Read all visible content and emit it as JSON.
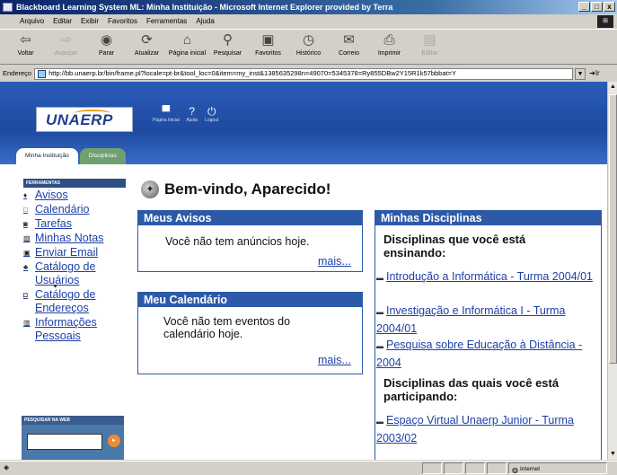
{
  "window": {
    "title": "Blackboard Learning System ML: Minha Instituição - Microsoft Internet Explorer provided by Terra"
  },
  "menu": [
    "Arquivo",
    "Editar",
    "Exibir",
    "Favoritos",
    "Ferramentas",
    "Ajuda"
  ],
  "toolbar": [
    {
      "icon": "back-arrow-icon",
      "label": "Voltar",
      "enabled": true
    },
    {
      "icon": "forward-arrow-icon",
      "label": "Avançar",
      "enabled": false
    },
    {
      "icon": "stop-icon",
      "label": "Parar",
      "enabled": true
    },
    {
      "icon": "refresh-icon",
      "label": "Atualizar",
      "enabled": true
    },
    {
      "icon": "home-icon",
      "label": "Página inicial",
      "enabled": true
    },
    {
      "icon": "search-icon",
      "label": "Pesquisar",
      "enabled": true
    },
    {
      "icon": "favorites-icon",
      "label": "Favoritos",
      "enabled": true
    },
    {
      "icon": "history-icon",
      "label": "Histórico",
      "enabled": true
    },
    {
      "icon": "mail-icon",
      "label": "Correio",
      "enabled": true
    },
    {
      "icon": "print-icon",
      "label": "Imprimir",
      "enabled": true
    },
    {
      "icon": "edit-icon",
      "label": "Editar",
      "enabled": false
    }
  ],
  "address": {
    "label": "Endereço",
    "url": "http://bb.unaerp.br/bin/frame.pl?locale=pt-br&tool_loc=0&item=my_inst&1385635298n=49070=5345378=Ry855DBw2Y15R1k57bbbat=Y",
    "go": "Ir"
  },
  "header": {
    "logo_text": "UNAERP",
    "icons": [
      {
        "icon": "home-icon",
        "label": "Página Inicial"
      },
      {
        "icon": "help-icon",
        "label": "Ajuda"
      },
      {
        "icon": "logout-icon",
        "label": "Logout"
      }
    ],
    "tabs": [
      "Minha Instituição",
      "Disciplinas"
    ]
  },
  "tools": {
    "header": "FERRAMENTAS",
    "items": [
      {
        "icon": "announcements-icon",
        "label": "Avisos"
      },
      {
        "icon": "calendar-icon",
        "label": "Calendário"
      },
      {
        "icon": "tasks-icon",
        "label": "Tarefas"
      },
      {
        "icon": "grades-icon",
        "label": "Minhas Notas"
      },
      {
        "icon": "email-icon",
        "label": "Enviar Email"
      },
      {
        "icon": "users-icon",
        "label": "Catálogo de Usuários"
      },
      {
        "icon": "address-book-icon",
        "label": "Catálogo de Endereços"
      },
      {
        "icon": "personal-info-icon",
        "label": "Informações Pessoais"
      }
    ]
  },
  "search": {
    "header": "PESQUISAR NA WEB",
    "value": ""
  },
  "welcome": {
    "text": "Bem-vindo, Aparecido!"
  },
  "avisos": {
    "title": "Meus Avisos",
    "message": "Você não tem anúncios hoje.",
    "more": "mais..."
  },
  "calendario": {
    "title": "Meu Calendário",
    "message": "Você não tem eventos do calendário hoje.",
    "more": "mais..."
  },
  "disciplinas": {
    "title": "Minhas Disciplinas",
    "teaching_heading": "Disciplinas que você está ensinando:",
    "teaching": [
      "Introdução a Informática - Turma 2004/01",
      "Investigação e Informática I - Turma 2004/01",
      "Pesquisa sobre Educação à Distância - 2004"
    ],
    "participating_heading": "Disciplinas das quais você está participando:",
    "participating": [
      "Espaço Virtual Unaerp Junior - Turma 2003/02"
    ]
  },
  "status": {
    "zone": "Internet"
  }
}
